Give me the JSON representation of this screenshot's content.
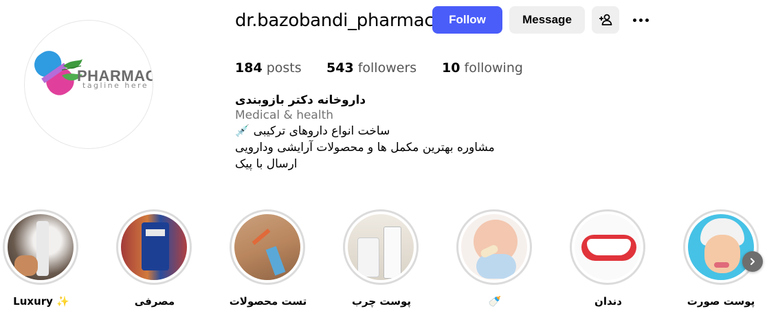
{
  "profile": {
    "username": "dr.bazobandi_pharmacy",
    "logo_word": "PHARMACY",
    "logo_tagline": "tagline here",
    "follow_label": "Follow",
    "message_label": "Message",
    "stats": {
      "posts_count": "184",
      "posts_label": "posts",
      "followers_count": "543",
      "followers_label": "followers",
      "following_count": "10",
      "following_label": "following"
    },
    "bio": {
      "name": "داروخانه دکتر بازوبندی",
      "category": "Medical & health",
      "line1": "ساخت انواع داروهای ترکیبی 💉",
      "line2": "مشاوره بهترین مکمل ها و محصولات آرایشی ودارویی",
      "line3": "ارسال با پیک"
    }
  },
  "highlights": [
    {
      "label": "Luxury ✨"
    },
    {
      "label": "مصرفی"
    },
    {
      "label": "تست محصولات"
    },
    {
      "label": "پوست چرب"
    },
    {
      "label": "🍼"
    },
    {
      "label": "دندان"
    },
    {
      "label": "پوست صورت"
    }
  ],
  "colors": {
    "follow_button": "#4a5df9",
    "secondary_button": "#efefef",
    "highlight_ring": "#dbdbdb",
    "logo_pink": "#e0409b",
    "logo_blue": "#2f9be0",
    "logo_green": "#3e9b3e"
  }
}
